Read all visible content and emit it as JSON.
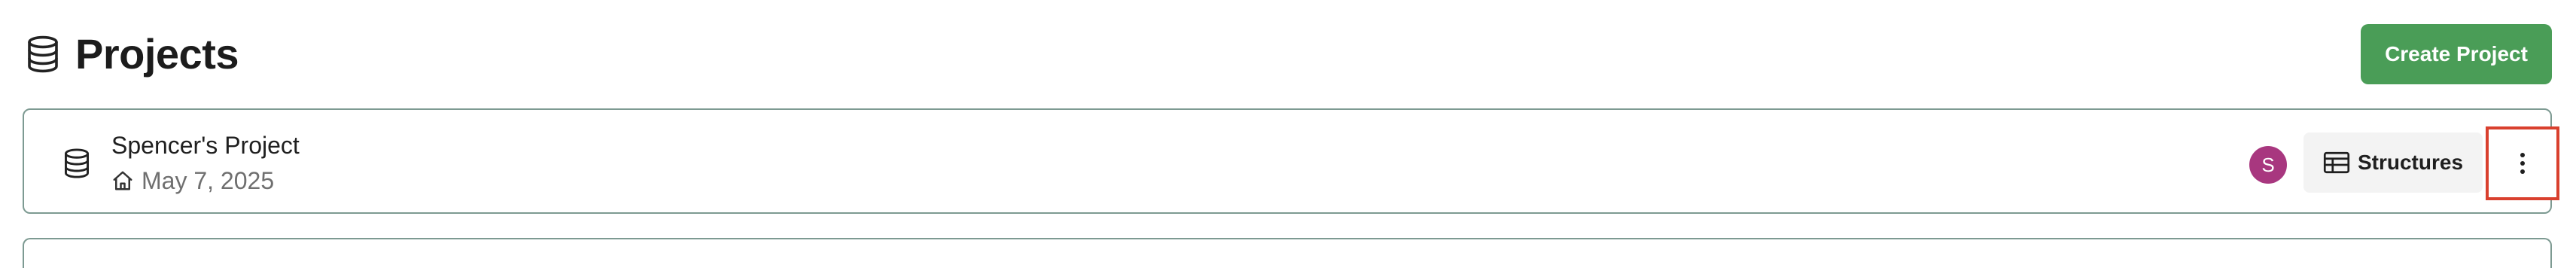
{
  "header": {
    "title": "Projects",
    "icon": "database-icon"
  },
  "actions": {
    "create_label": "Create Project",
    "create_color": "#4a9d57"
  },
  "projects": [
    {
      "name": "Spencer's Project",
      "date": "May 7, 2025",
      "icon": "database-icon",
      "date_icon": "home-icon",
      "avatar_initial": "S",
      "avatar_color": "#a8377f",
      "structures_label": "Structures",
      "structures_icon": "table-icon",
      "more_icon": "more-vertical-icon",
      "more_highlight_color": "#d9402e"
    }
  ]
}
